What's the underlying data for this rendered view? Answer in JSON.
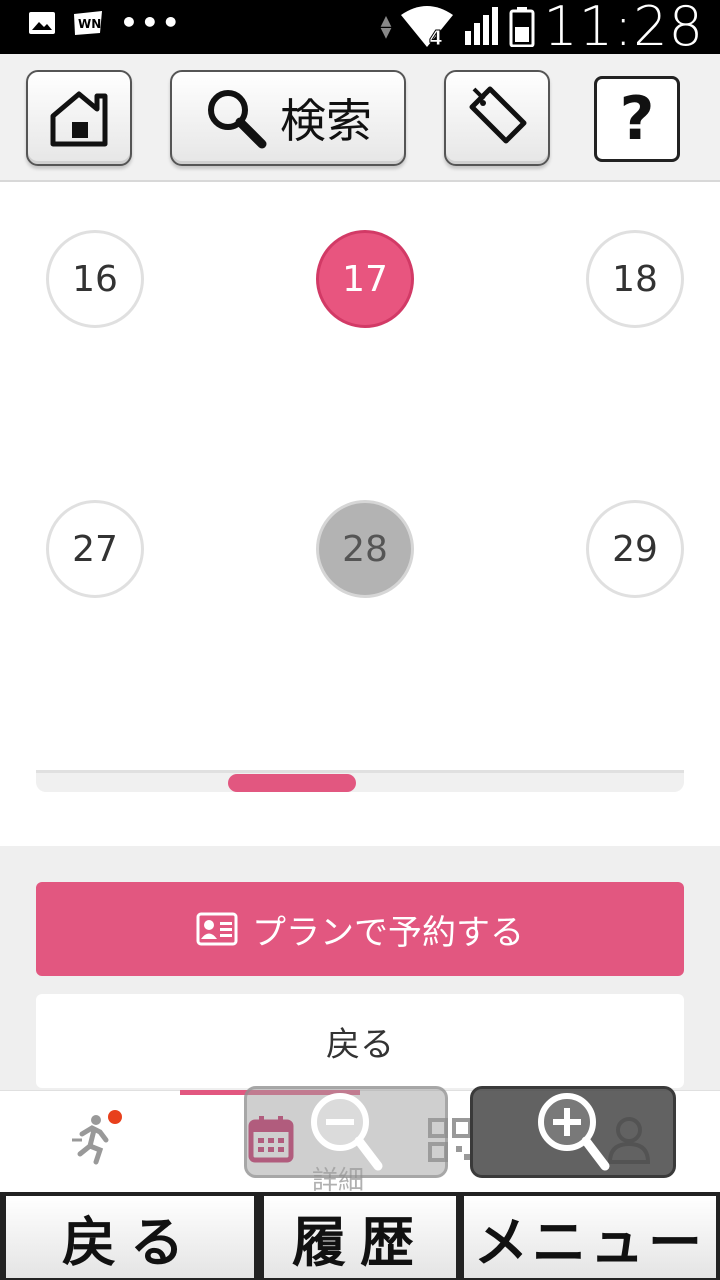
{
  "status_bar": {
    "time": "11:28",
    "network_label": "4",
    "more": "•••"
  },
  "toolbar": {
    "home": "home",
    "search_label": "検索",
    "tag": "tag",
    "help_label": "?"
  },
  "calendar": {
    "days": [
      {
        "label": "16",
        "state": "normal"
      },
      {
        "label": "17",
        "state": "selected"
      },
      {
        "label": "18",
        "state": "normal"
      },
      {
        "label": "27",
        "state": "normal"
      },
      {
        "label": "28",
        "state": "disabled"
      },
      {
        "label": "29",
        "state": "normal"
      }
    ],
    "scroll_position": 0.3
  },
  "actions": {
    "reserve_label": "プランで予約する",
    "back_label": "戻る"
  },
  "tab_bar": {
    "hidden_label": "詳細"
  },
  "bottom_nav": {
    "back": "戻る",
    "history": "履歴",
    "menu": "メニュー"
  },
  "colors": {
    "accent": "#e25780",
    "selected_day": "#e8557f",
    "disabled_day": "#b3b3b3"
  }
}
